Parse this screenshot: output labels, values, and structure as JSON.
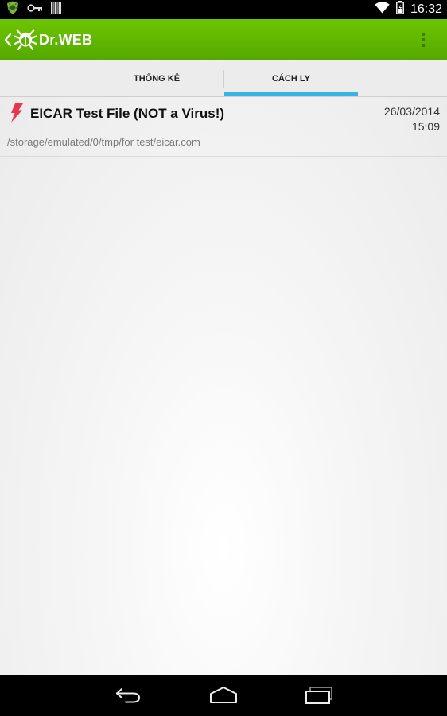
{
  "status_bar": {
    "time": "16:32",
    "icons": [
      "drweb-shield-icon",
      "vpn-key-icon",
      "barcode-icon",
      "wifi-icon",
      "battery-icon"
    ]
  },
  "app_bar": {
    "brand": "Dr.WEB",
    "logo": "drweb-spider-logo",
    "menu_icon": "overflow-menu-icon",
    "background_color": "#5cb400"
  },
  "tabs": [
    {
      "label": "THỐNG KÊ",
      "active": false
    },
    {
      "label": "CÁCH LY",
      "active": true
    }
  ],
  "tab_indicator_color": "#33b5e5",
  "quarantine": {
    "items": [
      {
        "icon": "threat-bolt-icon",
        "icon_color": "#e8364f",
        "name": "EICAR Test File (NOT a Virus!)",
        "date": "26/03/2014",
        "time": "15:09",
        "path": "/storage/emulated/0/tmp/for test/eicar.com"
      }
    ]
  },
  "nav_bar": {
    "buttons": [
      "back-icon",
      "home-icon",
      "recent-apps-icon"
    ]
  }
}
